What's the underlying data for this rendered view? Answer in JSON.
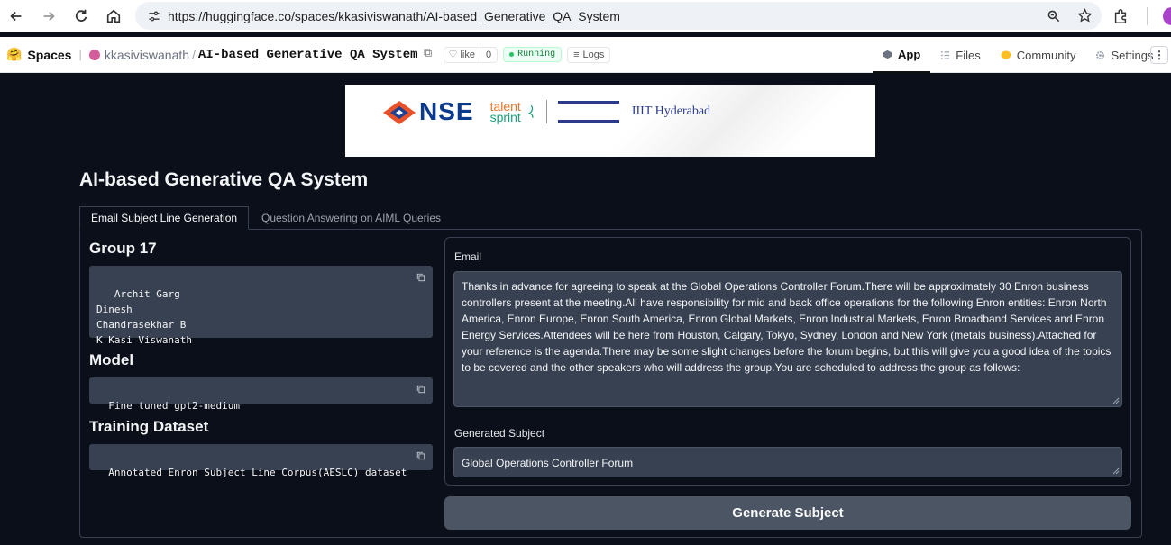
{
  "browser": {
    "url": "https://huggingface.co/spaces/kkasiviswanath/AI-based_Generative_QA_System"
  },
  "hf_header": {
    "spaces_label": "Spaces",
    "username": "kkasiviswanath",
    "repo": "AI-based_Generative_QA_System",
    "like_label": "like",
    "like_count": "0",
    "status": "Running",
    "logs_label": "Logs",
    "tabs": [
      {
        "label": "App",
        "icon": "cube-icon"
      },
      {
        "label": "Files",
        "icon": "files-icon"
      },
      {
        "label": "Community",
        "icon": "community-icon"
      },
      {
        "label": "Settings",
        "icon": "gear-icon"
      }
    ]
  },
  "banner": {
    "nse_text": "NSE",
    "talent_text": "talent",
    "sprint_text": "sprint",
    "iiit_text": "IIIT Hyderabad"
  },
  "app": {
    "title": "AI-based Generative QA System",
    "tabs": [
      "Email Subject Line Generation",
      "Question Answering on AIML Queries"
    ],
    "group_title": "Group 17",
    "group_members": " Archit Garg\nDinesh\nChandrasekhar B\nK Kasi Viswanath",
    "model_title": "Model",
    "model_value": "Fine tuned gpt2-medium",
    "dataset_title": "Training Dataset",
    "dataset_value": "Annotated Enron Subject Line Corpus(AESLC) dataset",
    "email_label": "Email",
    "email_value": "Thanks in advance for agreeing to speak at the Global Operations Controller  Forum.There will be approximately 30 Enron business controllers present at  the meeting.All have responsibility for mid and back office operations for  the following Enron entities:  Enron North America, Enron Europe, Enron South  America, Enron Global Markets, Enron Industrial Markets, Enron Broadband  Services and Enron Energy Services.Attendees will be here from Houston,  Calgary, Tokyo, Sydney, London and New York (metals business).Attached for your reference is the agenda.There may be some slight changes  before the forum begins, but this will give you a good idea of the topics to  be covered and the other speakers who will address the group.You are scheduled to address the group as follows:",
    "subject_label": "Generated Subject",
    "subject_value": "Global Operations Controller Forum",
    "button_label": "Generate Subject"
  },
  "colors": {
    "background": "#0b0f19",
    "box": "#374151",
    "button": "#4b5563",
    "running_green": "#22c55e"
  }
}
